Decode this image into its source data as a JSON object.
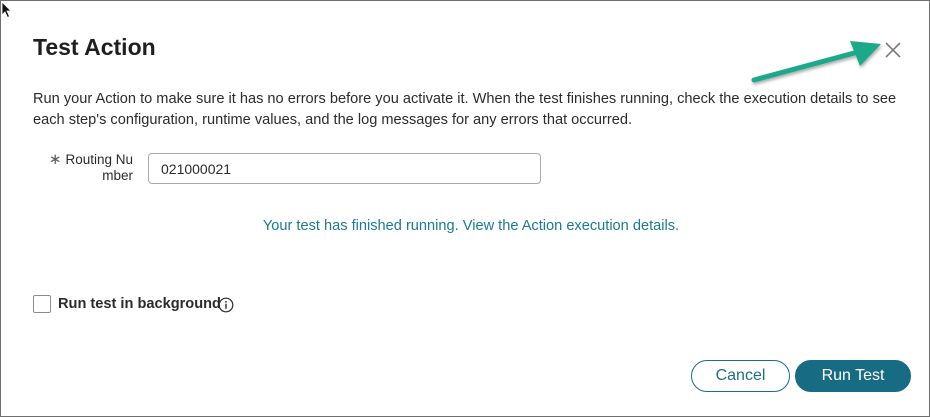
{
  "dialog": {
    "title": "Test Action",
    "description": "Run your Action to make sure it has no errors before you activate it. When the test finishes running, check the execution details to see each step's configuration, runtime values, and the log messages for any errors that occurred.",
    "close_icon": "close-icon"
  },
  "form": {
    "routing_number": {
      "required_marker": "∗",
      "label_line1": "Routing Nu",
      "label_line2": "mber",
      "value": "021000021"
    }
  },
  "status": {
    "message": "Your test has finished running. View the Action execution details."
  },
  "options": {
    "background_label": "Run test in background",
    "background_checked": false,
    "info_icon": "info-icon"
  },
  "buttons": {
    "cancel_label": "Cancel",
    "run_label": "Run Test"
  },
  "colors": {
    "accent": "#176b82",
    "link": "#1a7a92",
    "annotation_arrow": "#1fa98a"
  }
}
